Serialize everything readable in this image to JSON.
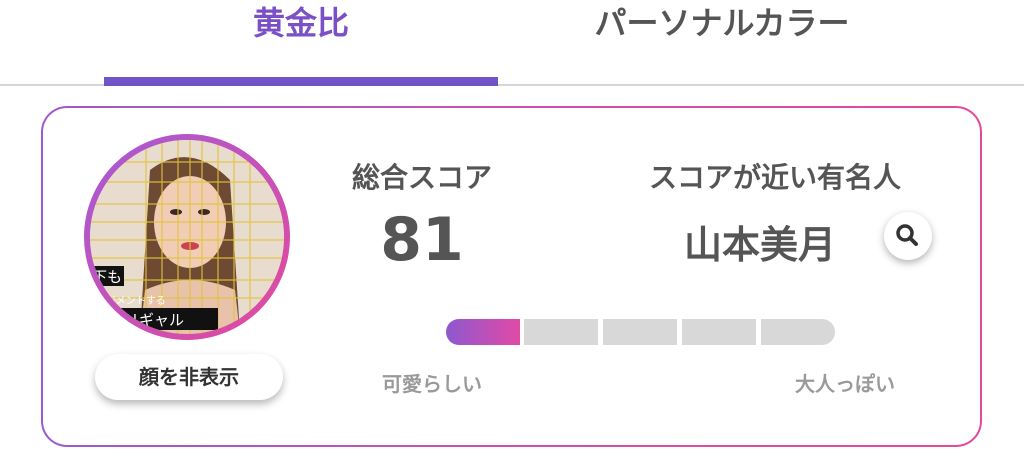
{
  "tabs": {
    "golden_ratio": "黄金比",
    "personal_color": "パーソナルカラー"
  },
  "profile": {
    "hide_face_label": "顔を非表示",
    "photo_overlay_texts": [
      "下も",
      "ージメントする",
      "キャリギャル"
    ]
  },
  "score": {
    "label": "総合スコア",
    "value": "81"
  },
  "celebrity": {
    "label": "スコアが近い有名人",
    "name": "山本美月"
  },
  "scale": {
    "left_label": "可愛らしい",
    "right_label": "大人っぽい",
    "segments": 5,
    "active_segment": 1
  },
  "colors": {
    "accent": "#7b4fc6",
    "gradient_start": "#9b5ad0",
    "gradient_end": "#e44a9a"
  },
  "icons": {
    "search": "magnifier-icon"
  }
}
